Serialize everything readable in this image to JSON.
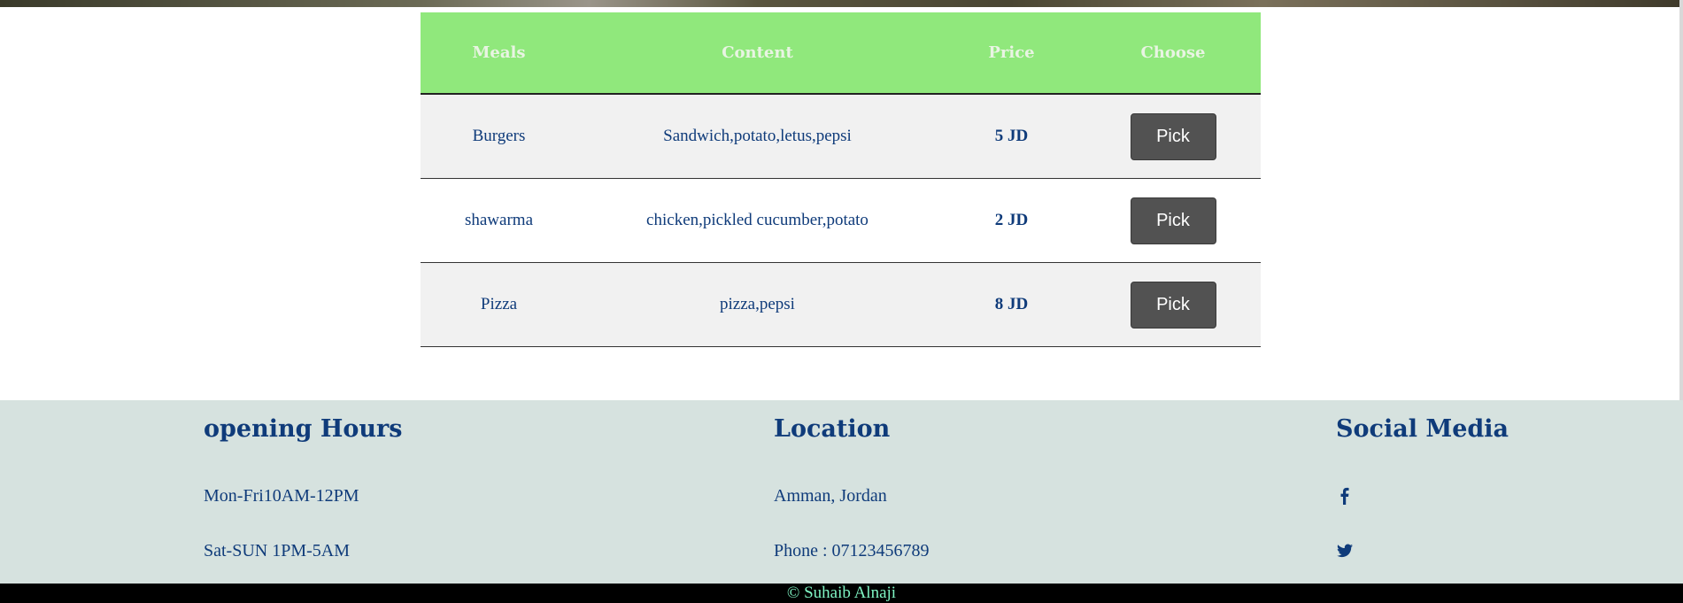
{
  "menu": {
    "headers": [
      "Meals",
      "Content",
      "Price",
      "Choose"
    ],
    "rows": [
      {
        "meal": "Burgers",
        "content": "Sandwich,potato,letus,pepsi",
        "price": "5 JD",
        "action": "Pick"
      },
      {
        "meal": "shawarma",
        "content": "chicken,pickled cucumber,potato",
        "price": "2 JD",
        "action": "Pick"
      },
      {
        "meal": "Pizza",
        "content": "pizza,pepsi",
        "price": "8 JD",
        "action": "Pick"
      }
    ]
  },
  "footer": {
    "hours": {
      "title": "opening Hours",
      "line1": "Mon-Fri10AM-12PM",
      "line2": "Sat-SUN 1PM-5AM"
    },
    "location": {
      "title": "Location",
      "line1": "Amman, Jordan",
      "line2": "Phone : 07123456789"
    },
    "social": {
      "title": "Social Media",
      "icons": [
        "facebook-icon",
        "twitter-icon"
      ]
    }
  },
  "copyright": "© Suhaib Alnaji",
  "colors": {
    "header_bg": "#90e87c",
    "text": "#0f3b7a",
    "button_bg": "#525252",
    "footer_bg": "#d6e2df",
    "copyright_text": "#7ff5c4"
  }
}
